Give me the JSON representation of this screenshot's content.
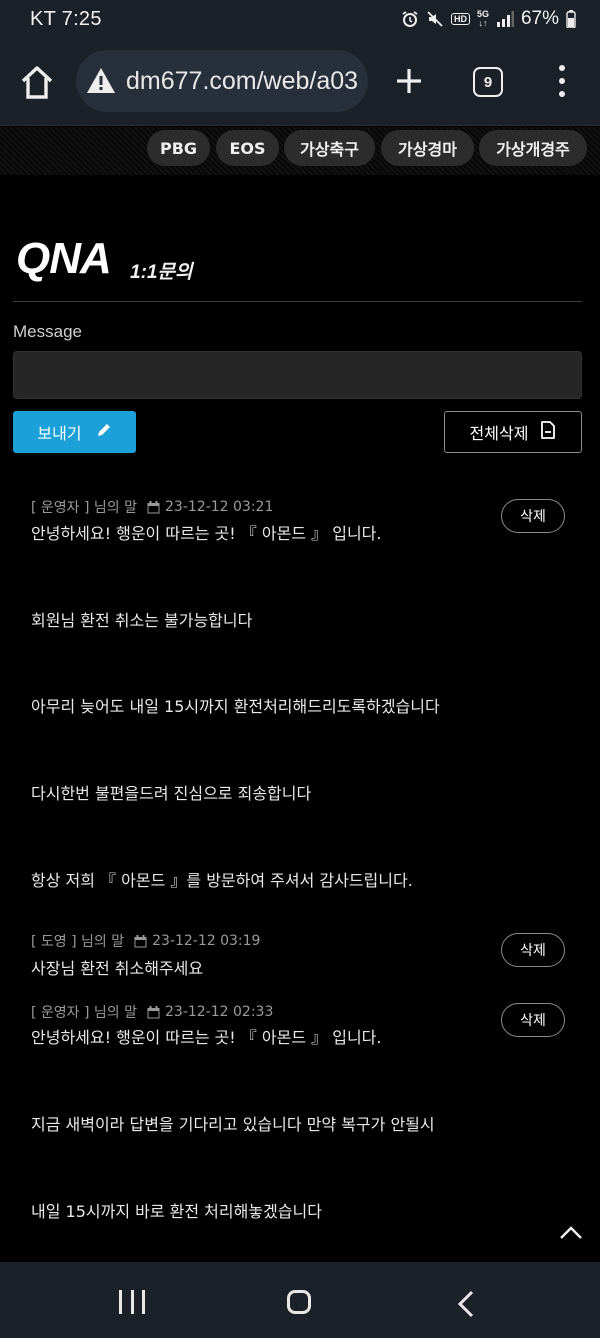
{
  "status_bar": {
    "carrier_time": "KT 7:25",
    "network": "5G",
    "hd": "HD",
    "battery": "67%"
  },
  "browser": {
    "url": "dm677.com/web/a03",
    "tab_count": "9",
    "icons": {
      "home": "home-icon",
      "warning": "warning-icon",
      "new_tab": "plus-icon",
      "menu": "more-vert-icon"
    }
  },
  "categories": [
    "PBG",
    "EOS",
    "가상축구",
    "가상경마",
    "가상개경주"
  ],
  "page": {
    "title": "QNA",
    "subtitle": "1:1문의",
    "message_label": "Message",
    "message_value": "",
    "send_label": "보내기",
    "delete_all_label": "전체삭제"
  },
  "messages": [
    {
      "author": "[ 운영자 ] 님의 말",
      "date": "23-12-12 03:21",
      "delete_label": "삭제",
      "lines": [
        "안녕하세요! 행운이 따르는 곳! 『 아몬드 』 입니다.",
        "회원님 환전 취소는 불가능합니다",
        "아무리 늦어도 내일 15시까지 환전처리해드리도록하겠습니다",
        "다시한번 불편을드려 진심으로 죄송합니다",
        "항상 저희 『 아몬드 』를 방문하여 주셔서 감사드립니다."
      ]
    },
    {
      "author": "[ 도영 ] 님의 말",
      "date": "23-12-12 03:19",
      "delete_label": "삭제",
      "lines": [
        "사장님 환전 취소해주세요"
      ]
    },
    {
      "author": "[ 운영자 ] 님의 말",
      "date": "23-12-12 02:33",
      "delete_label": "삭제",
      "lines": [
        "안녕하세요! 행운이 따르는 곳! 『 아몬드 』 입니다.",
        "지금 새벽이라 답변을 기다리고 있습니다 만약 복구가 안될시",
        "내일 15시까지 바로 환전 처리해놓겠습니다"
      ]
    }
  ],
  "colors": {
    "background": "#000000",
    "system_bar": "#1b2129",
    "send_button": "#1ba0d8",
    "pill": "#2c2c2c"
  }
}
